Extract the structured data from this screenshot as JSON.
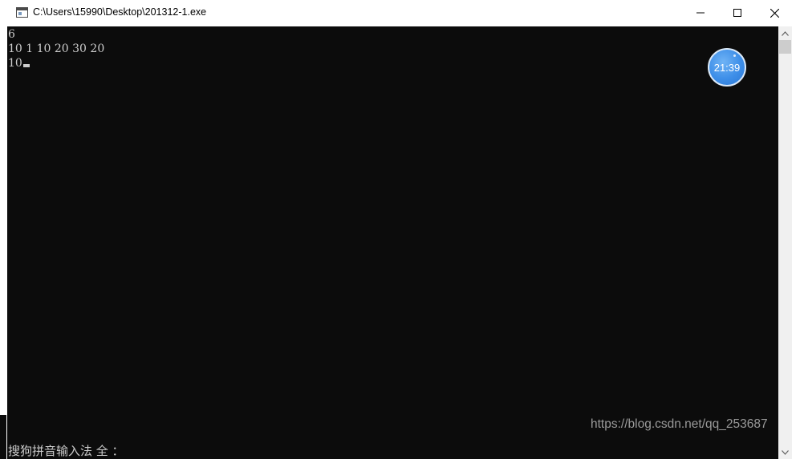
{
  "window": {
    "title": "C:\\Users\\15990\\Desktop\\201312-1.exe",
    "minimize_icon": "minimize-icon",
    "maximize_icon": "maximize-icon",
    "close_icon": "close-icon",
    "app_icon": "console-app-icon"
  },
  "console": {
    "lines": [
      "6",
      "10 1 10 20 30 20",
      "10"
    ],
    "ime_status": "搜狗拼音输入法 全 ：",
    "background_color": "#0c0c0c",
    "text_color": "#cccccc"
  },
  "clock_widget": {
    "time": "21:39",
    "color": "#3d8ee8"
  },
  "watermark": {
    "text": "https://blog.csdn.net/qq_253687"
  },
  "scrollbar": {
    "up_icon": "scroll-up-arrow-icon",
    "down_icon": "scroll-down-arrow-icon"
  }
}
